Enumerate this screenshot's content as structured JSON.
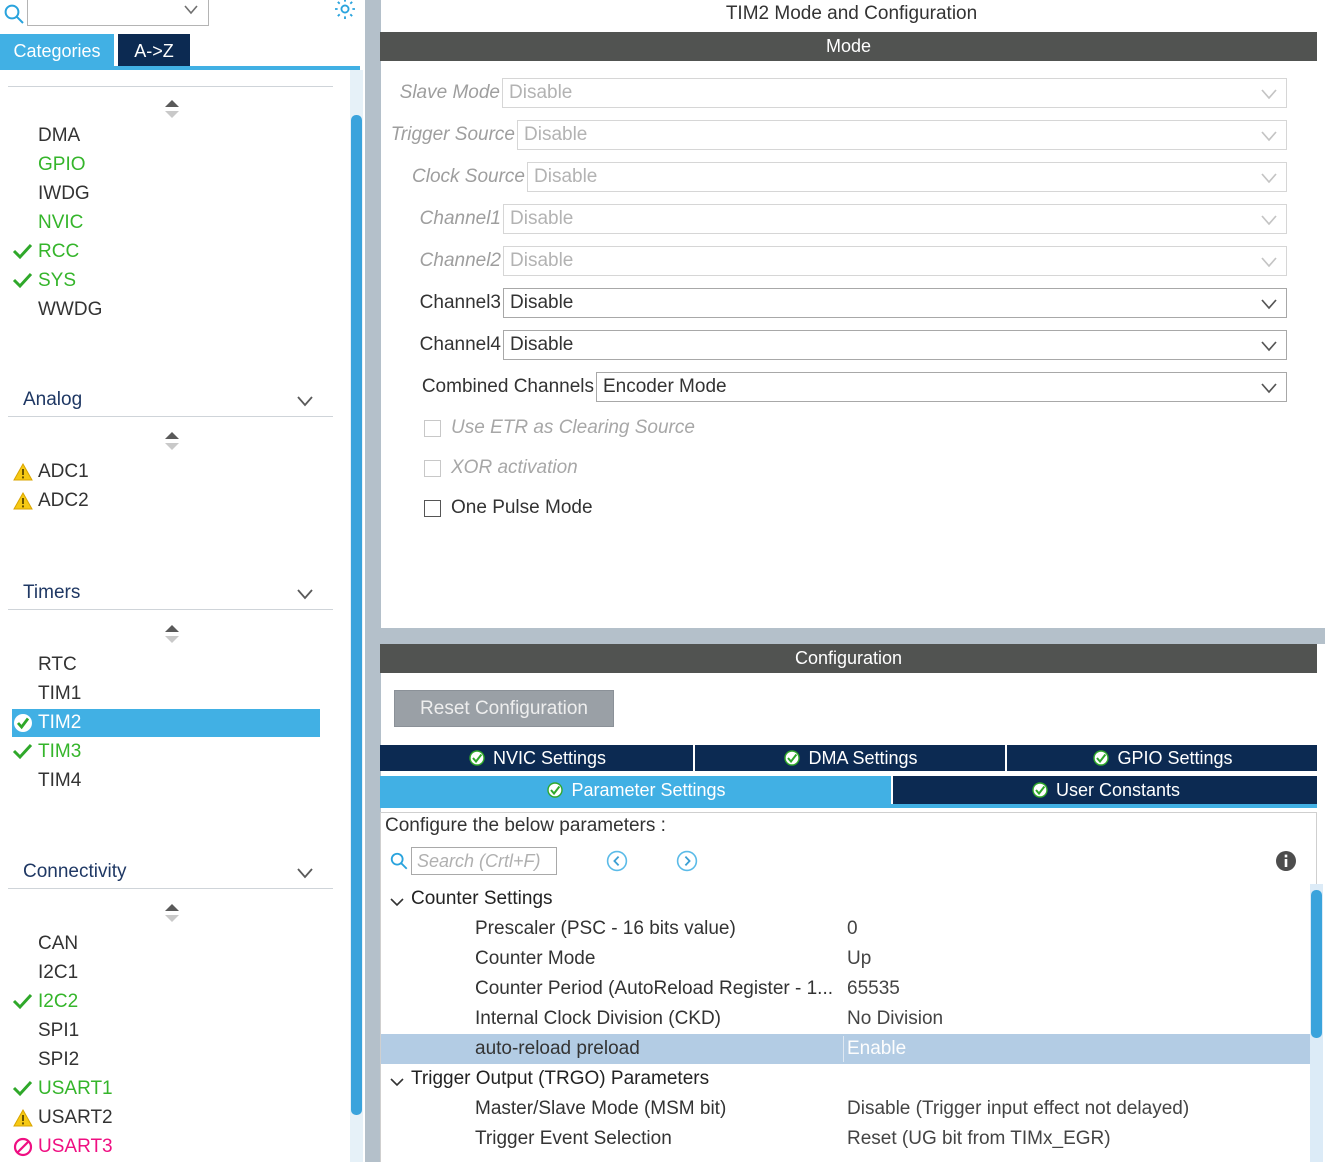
{
  "sidebar": {
    "search": {
      "value": "",
      "placeholder": "",
      "icon": "search-icon"
    },
    "gear_icon": "gear-icon",
    "tabs": [
      {
        "label": "Categories",
        "active": true
      },
      {
        "label": "A->Z",
        "active": false
      }
    ],
    "sections": [
      {
        "title": "",
        "title_truncated": true,
        "items": [
          {
            "label": "DMA",
            "status": "none",
            "selected": false
          },
          {
            "label": "GPIO",
            "status": "ok-text",
            "selected": false
          },
          {
            "label": "IWDG",
            "status": "none",
            "selected": false
          },
          {
            "label": "NVIC",
            "status": "ok-text",
            "selected": false
          },
          {
            "label": "RCC",
            "status": "check",
            "selected": false
          },
          {
            "label": "SYS",
            "status": "check",
            "selected": false
          },
          {
            "label": "WWDG",
            "status": "none",
            "selected": false
          }
        ]
      },
      {
        "title": "Analog",
        "items": [
          {
            "label": "ADC1",
            "status": "warning",
            "selected": false
          },
          {
            "label": "ADC2",
            "status": "warning",
            "selected": false
          }
        ]
      },
      {
        "title": "Timers",
        "items": [
          {
            "label": "RTC",
            "status": "none",
            "selected": false
          },
          {
            "label": "TIM1",
            "status": "none",
            "selected": false
          },
          {
            "label": "TIM2",
            "status": "check-badge",
            "selected": true
          },
          {
            "label": "TIM3",
            "status": "check",
            "selected": false
          },
          {
            "label": "TIM4",
            "status": "none",
            "selected": false
          }
        ]
      },
      {
        "title": "Connectivity",
        "items": [
          {
            "label": "CAN",
            "status": "none",
            "selected": false
          },
          {
            "label": "I2C1",
            "status": "none",
            "selected": false
          },
          {
            "label": "I2C2",
            "status": "check",
            "selected": false
          },
          {
            "label": "SPI1",
            "status": "none",
            "selected": false
          },
          {
            "label": "SPI2",
            "status": "none",
            "selected": false
          },
          {
            "label": "USART1",
            "status": "check",
            "selected": false
          },
          {
            "label": "USART2",
            "status": "warning",
            "selected": false
          },
          {
            "label": "USART3",
            "status": "forbidden",
            "selected": false
          }
        ]
      }
    ]
  },
  "main": {
    "title": "TIM2 Mode and Configuration",
    "mode": {
      "band_label": "Mode",
      "rows": [
        {
          "label": "Slave Mode",
          "value": "Disable",
          "disabled": true
        },
        {
          "label": "Trigger Source",
          "value": "Disable",
          "disabled": true
        },
        {
          "label": "Clock Source",
          "value": "Disable",
          "disabled": true
        },
        {
          "label": "Channel1",
          "value": "Disable",
          "disabled": true
        },
        {
          "label": "Channel2",
          "value": "Disable",
          "disabled": true
        },
        {
          "label": "Channel3",
          "value": "Disable",
          "disabled": false
        },
        {
          "label": "Channel4",
          "value": "Disable",
          "disabled": false
        },
        {
          "label": "Combined Channels",
          "value": "Encoder Mode",
          "disabled": false
        }
      ],
      "checkboxes": [
        {
          "label": "Use ETR as Clearing Source",
          "checked": false,
          "disabled": true
        },
        {
          "label": "XOR activation",
          "checked": false,
          "disabled": true
        },
        {
          "label": "One Pulse Mode",
          "checked": false,
          "disabled": false
        }
      ]
    },
    "config": {
      "band_label": "Configuration",
      "reset_button": "Reset Configuration",
      "tabs_row1": [
        {
          "label": "NVIC Settings",
          "active": false
        },
        {
          "label": "DMA Settings",
          "active": false
        },
        {
          "label": "GPIO Settings",
          "active": false
        }
      ],
      "tabs_row2": [
        {
          "label": "Parameter Settings",
          "active": true
        },
        {
          "label": "User Constants",
          "active": false
        }
      ],
      "note": "Configure the below parameters :",
      "search_placeholder": "Search (Crtl+F)",
      "prev_icon": "chevron-left-circle-icon",
      "next_icon": "chevron-right-circle-icon",
      "info_icon": "info-icon",
      "groups": [
        {
          "name": "Counter Settings",
          "expanded": true,
          "params": [
            {
              "name": "Prescaler (PSC - 16 bits value)",
              "value": "0",
              "highlight": false
            },
            {
              "name": "Counter Mode",
              "value": "Up",
              "highlight": false
            },
            {
              "name": "Counter Period (AutoReload Register - 1...",
              "value": "65535",
              "highlight": false
            },
            {
              "name": "Internal Clock Division (CKD)",
              "value": "No Division",
              "highlight": false
            },
            {
              "name": "auto-reload preload",
              "value": "Enable",
              "highlight": true
            }
          ]
        },
        {
          "name": "Trigger Output (TRGO) Parameters",
          "expanded": true,
          "params": [
            {
              "name": "Master/Slave Mode (MSM bit)",
              "value": "Disable (Trigger input effect not delayed)",
              "highlight": false
            },
            {
              "name": "Trigger Event Selection",
              "value": "Reset (UG bit from TIMx_EGR)",
              "highlight": false
            }
          ]
        }
      ]
    }
  },
  "colors": {
    "accent_blue": "#41b0e4",
    "dark_navy": "#0c2a52",
    "band_gray": "#515351",
    "ok_green": "#35b52b",
    "warn_yellow": "#f5c518",
    "forbidden_pink": "#ef0f82",
    "highlight_row": "#b3cce4"
  }
}
